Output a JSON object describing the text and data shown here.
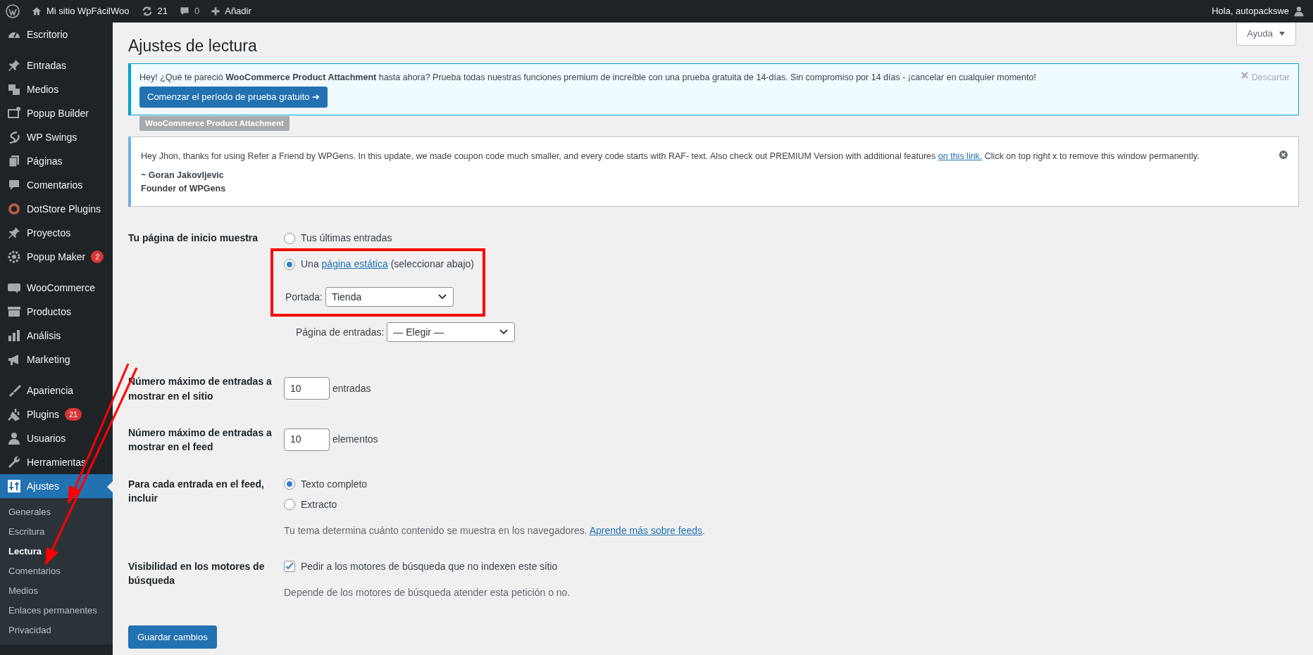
{
  "admin_bar": {
    "site_name": "Mi sitio WpFácilWoo",
    "updates_count": "21",
    "comments_count": "0",
    "add_label": "Añadir",
    "greeting": "Hola, autopackswe"
  },
  "sidebar": {
    "groups": [
      [
        {
          "label": "Escritorio",
          "selected": false
        }
      ],
      [
        {
          "label": "Entradas",
          "selected": false
        },
        {
          "label": "Medios",
          "selected": false
        },
        {
          "label": "Popup Builder",
          "selected": false
        },
        {
          "label": "WP Swings",
          "selected": false
        },
        {
          "label": "Páginas",
          "selected": false
        },
        {
          "label": "Comentarios",
          "selected": false
        },
        {
          "label": "DotStore Plugins",
          "selected": false
        },
        {
          "label": "Proyectos",
          "selected": false
        },
        {
          "label": "Popup Maker",
          "badge": "2",
          "selected": false
        }
      ],
      [
        {
          "label": "WooCommerce",
          "selected": false
        },
        {
          "label": "Productos",
          "selected": false
        },
        {
          "label": "Análisis",
          "selected": false
        },
        {
          "label": "Marketing",
          "selected": false
        }
      ],
      [
        {
          "label": "Apariencia",
          "selected": false
        },
        {
          "label": "Plugins",
          "badge": "21",
          "selected": false
        },
        {
          "label": "Usuarios",
          "selected": false
        },
        {
          "label": "Herramientas",
          "selected": false
        },
        {
          "label": "Ajustes",
          "selected": true
        }
      ]
    ],
    "submenu": [
      {
        "label": "Generales",
        "selected": false
      },
      {
        "label": "Escritura",
        "selected": false
      },
      {
        "label": "Lectura",
        "selected": true
      },
      {
        "label": "Comentarios",
        "selected": false
      },
      {
        "label": "Medios",
        "selected": false
      },
      {
        "label": "Enlaces permanentes",
        "selected": false
      },
      {
        "label": "Privacidad",
        "selected": false
      }
    ]
  },
  "page": {
    "title": "Ajustes de lectura",
    "help_button": "Ayuda"
  },
  "trial_notice": {
    "text": "Hey! ¿Qué te pareció **WooCommerce Product Attachment** hasta ahora? Prueba todas nuestras funciones premium de increíble con una prueba gratuita de 14-días. Sin compromiso por 14 días - ¡cancelar en cualquier momento!",
    "button": "Comenzar el período de prueba gratuito ➔",
    "dismiss": "Descartar",
    "tag": "WooCommerce Product Attachment"
  },
  "refer_notice": {
    "text": "Hey Jhon, thanks for using Refer a Friend by WPGens. In this update, we made coupon code much smaller, and every code starts with RAF- text. Also check out PREMIUM Version with additional features",
    "link": "on this link.",
    "text_after": "Click on top right x to remove this window permanently.",
    "signature": [
      "~ Goran Jakovljevic",
      "Founder of WPGens"
    ]
  },
  "form": {
    "front_page": {
      "label": "Tu página de inicio muestra",
      "options": [
        {
          "text": "Tus últimas entradas",
          "selected": false
        },
        {
          "text": "Una",
          "link": "página estática",
          "text_after": "(seleccionar abajo)",
          "selected": true
        }
      ],
      "highlighted": true,
      "selects": [
        {
          "label": "Portada:",
          "value": "Tienda"
        },
        {
          "label": "Página de entradas:",
          "value": "— Elegir —"
        }
      ]
    },
    "numbers": [
      {
        "label": "Número máximo de entradas a mostrar en el sitio",
        "value": "10",
        "unit": "entradas"
      },
      {
        "label": "Número máximo de entradas a mostrar en el feed",
        "value": "10",
        "unit": "elementos"
      }
    ],
    "feed": {
      "label": "Para cada entrada en el feed, incluir",
      "options": [
        {
          "text": "Texto completo",
          "selected": true
        },
        {
          "text": "Extracto",
          "selected": false
        }
      ],
      "description": "Tu tema determina cuánto contenido se muestra en los navegadores.",
      "link": "Aprende más sobre feeds",
      "after": "."
    },
    "visibility": {
      "label": "Visibilidad en los motores de búsqueda",
      "checkbox": "Pedir a los motores de búsqueda que no indexen este sitio",
      "checked": true,
      "description": "Depende de los motores de búsqueda atender esta petición o no."
    },
    "save_button": "Guardar cambios"
  }
}
